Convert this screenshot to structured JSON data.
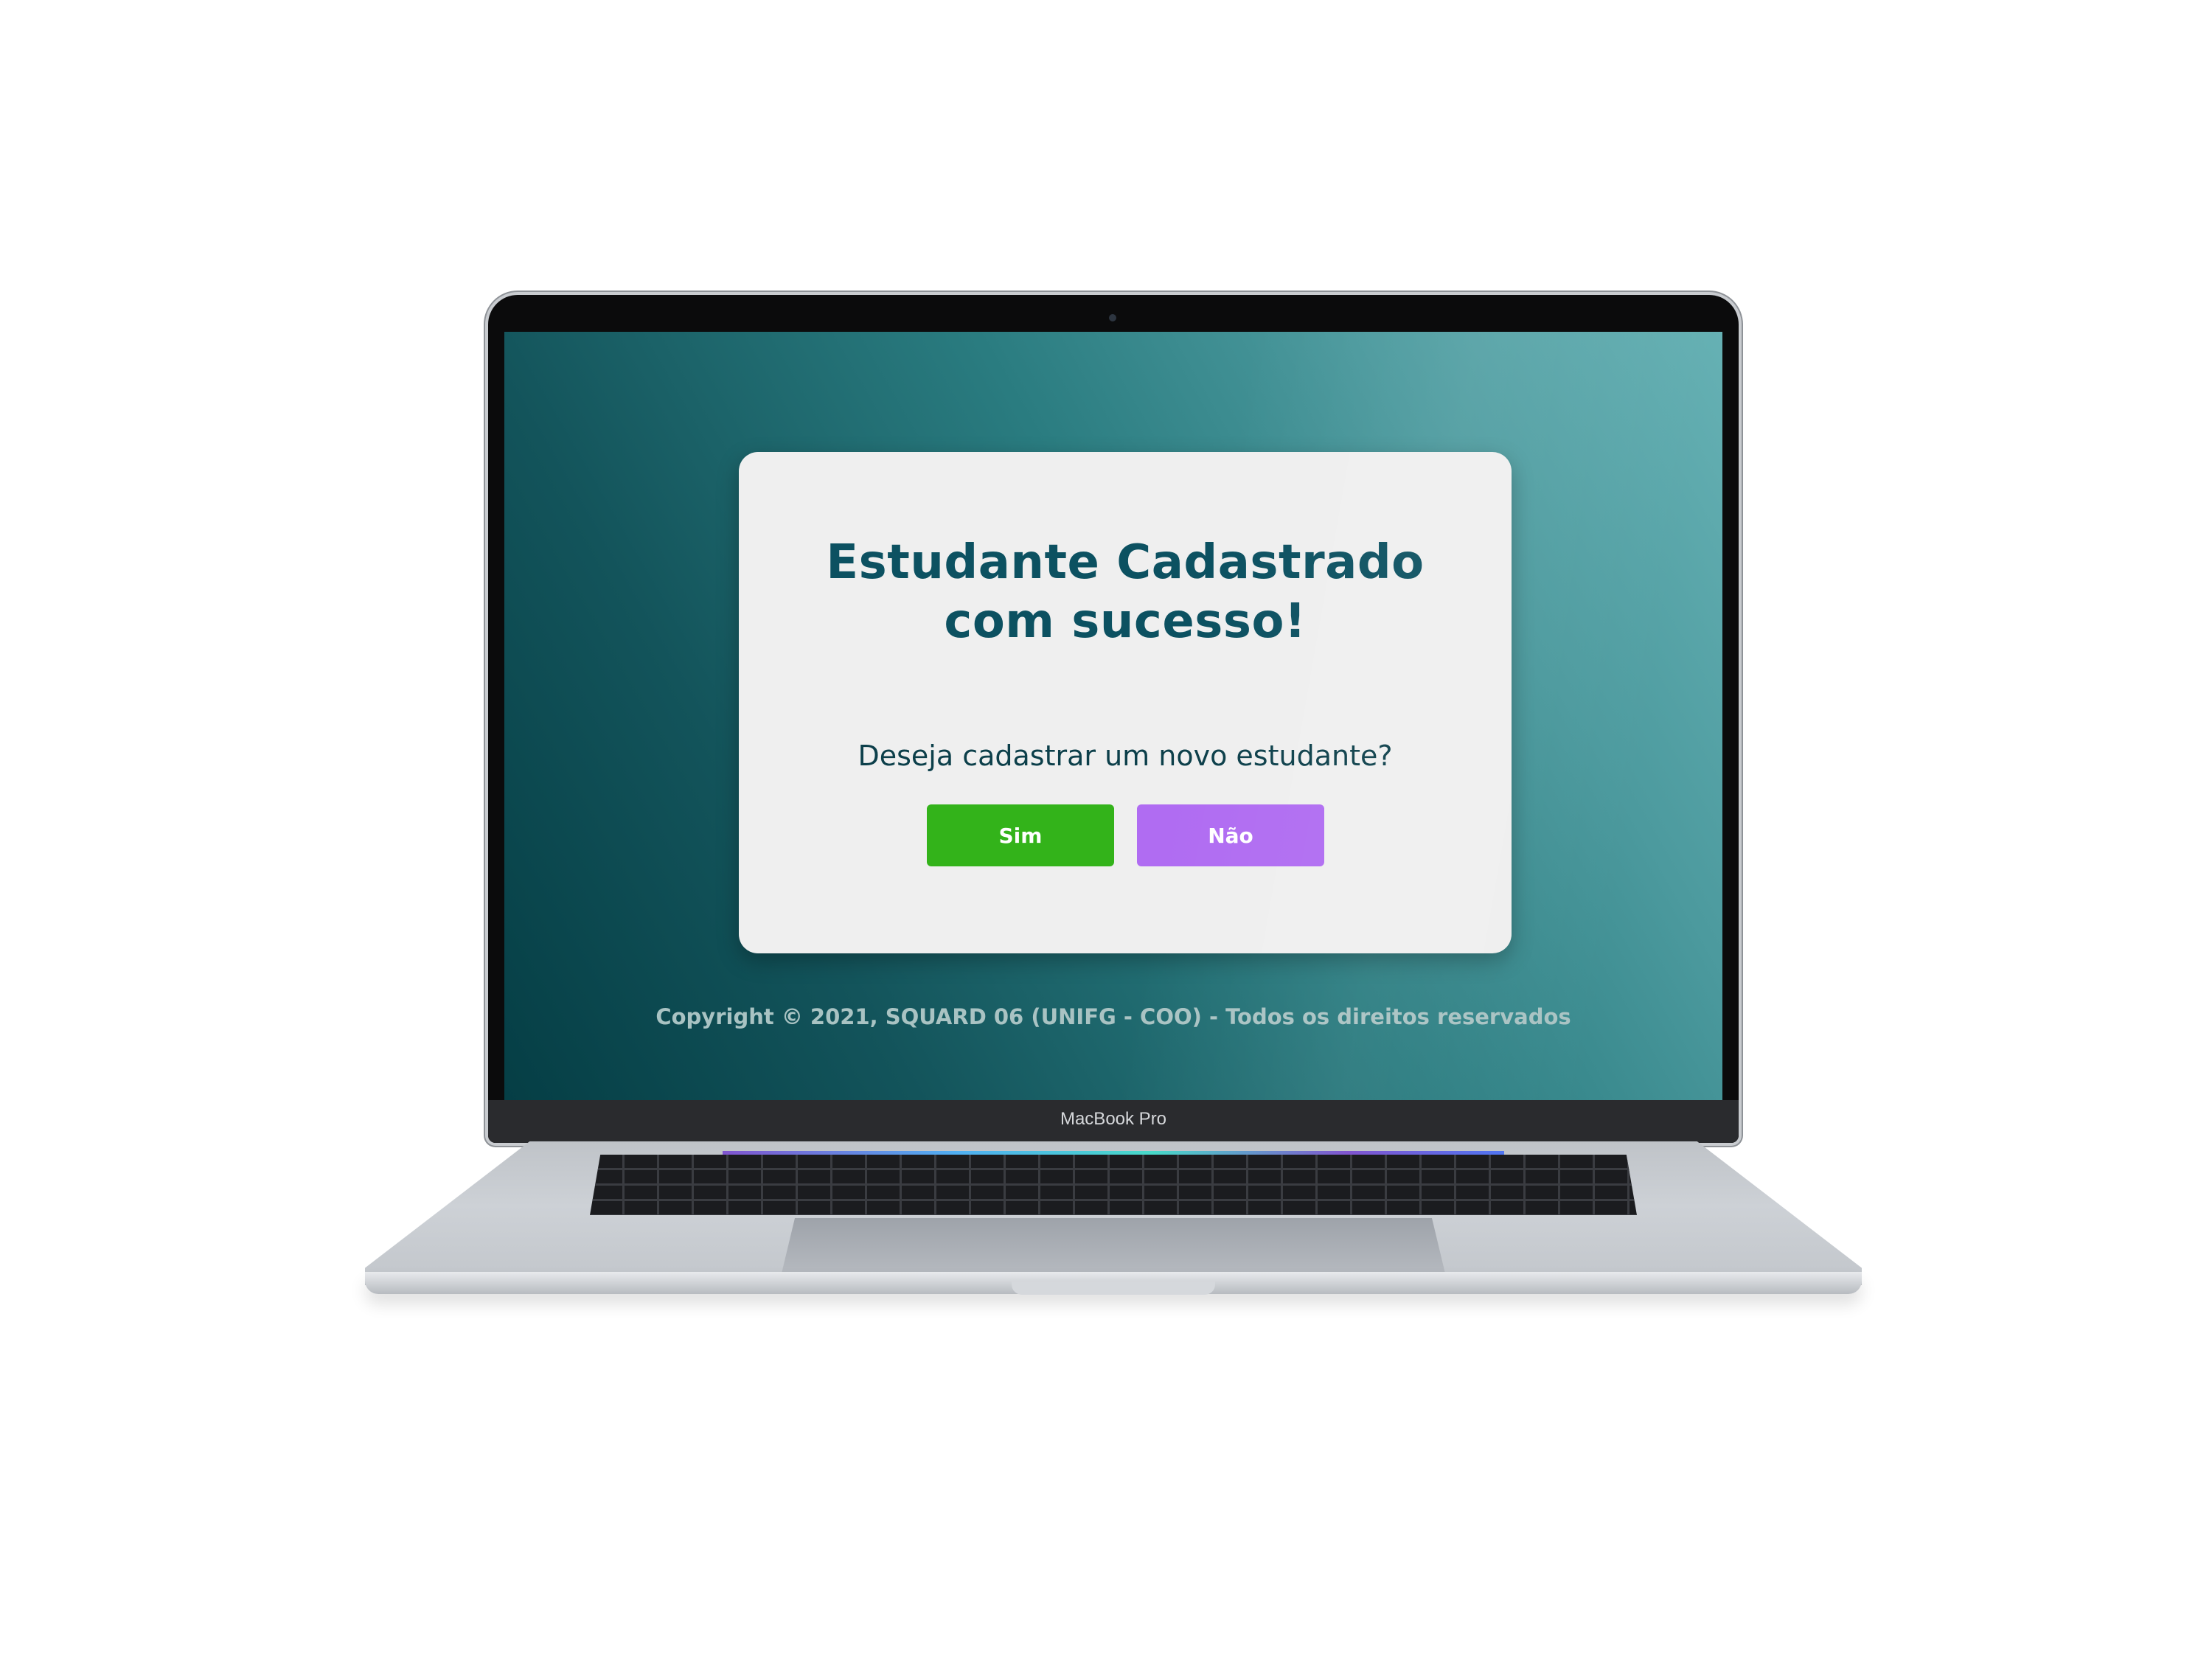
{
  "dialog": {
    "title": "Estudante Cadastrado com sucesso!",
    "question": "Deseja cadastrar um novo estudante?",
    "yes_label": "Sim",
    "no_label": "Não"
  },
  "footer": {
    "copyright": "Copyright © 2021, SQUARD 06 (UNIFG - COO) - Todos os direitos reservados"
  },
  "device": {
    "model_label": "MacBook Pro"
  },
  "colors": {
    "title": "#0c5161",
    "yes_button": "#33b31a",
    "no_button": "#b06cf2",
    "card_background": "#efefef",
    "screen_gradient_dark": "#053e45",
    "screen_gradient_light": "#66b1b4"
  }
}
